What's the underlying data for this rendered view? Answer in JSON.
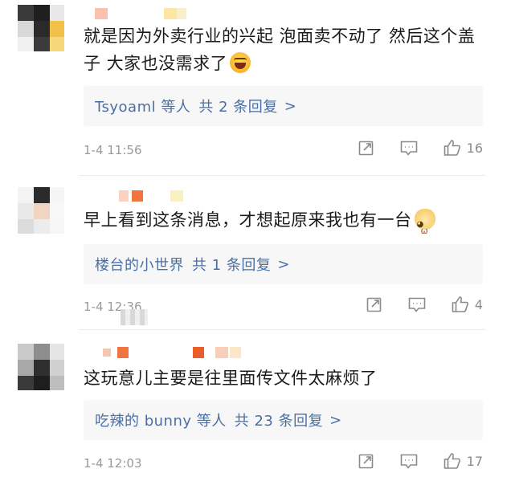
{
  "comments": [
    {
      "text": "就是因为外卖行业的兴起 泡面卖不动了 然后这个盖子 大家也没需求了",
      "emoji": "laugh-emoji",
      "replies": {
        "who": "Tsyoaml 等人",
        "count": "共 2 条回复",
        "chevron": ">"
      },
      "time": "1-4 11:56",
      "likes": "16"
    },
    {
      "text": "早上看到这条消息，才想起原来我也有一台",
      "emoji": "cat-emoji",
      "replies": {
        "who": "楼台的小世界",
        "count": "共 1 条回复",
        "chevron": ">"
      },
      "time": "1-4 12:36",
      "likes": "4"
    },
    {
      "text": "这玩意儿主要是往里面传文件太麻烦了",
      "emoji": "",
      "replies": {
        "who": "吃辣的 bunny 等人",
        "count": "共 23 条回复",
        "chevron": ">"
      },
      "time": "1-4 12:03",
      "likes": "17"
    }
  ],
  "icons": {
    "repost": "repost-icon",
    "comment": "comment-icon",
    "like": "thumbs-up-icon"
  },
  "colors": {
    "link": "#4a6fa5",
    "meta": "#9a9a9a",
    "reply_bg": "#f7f7f7"
  }
}
